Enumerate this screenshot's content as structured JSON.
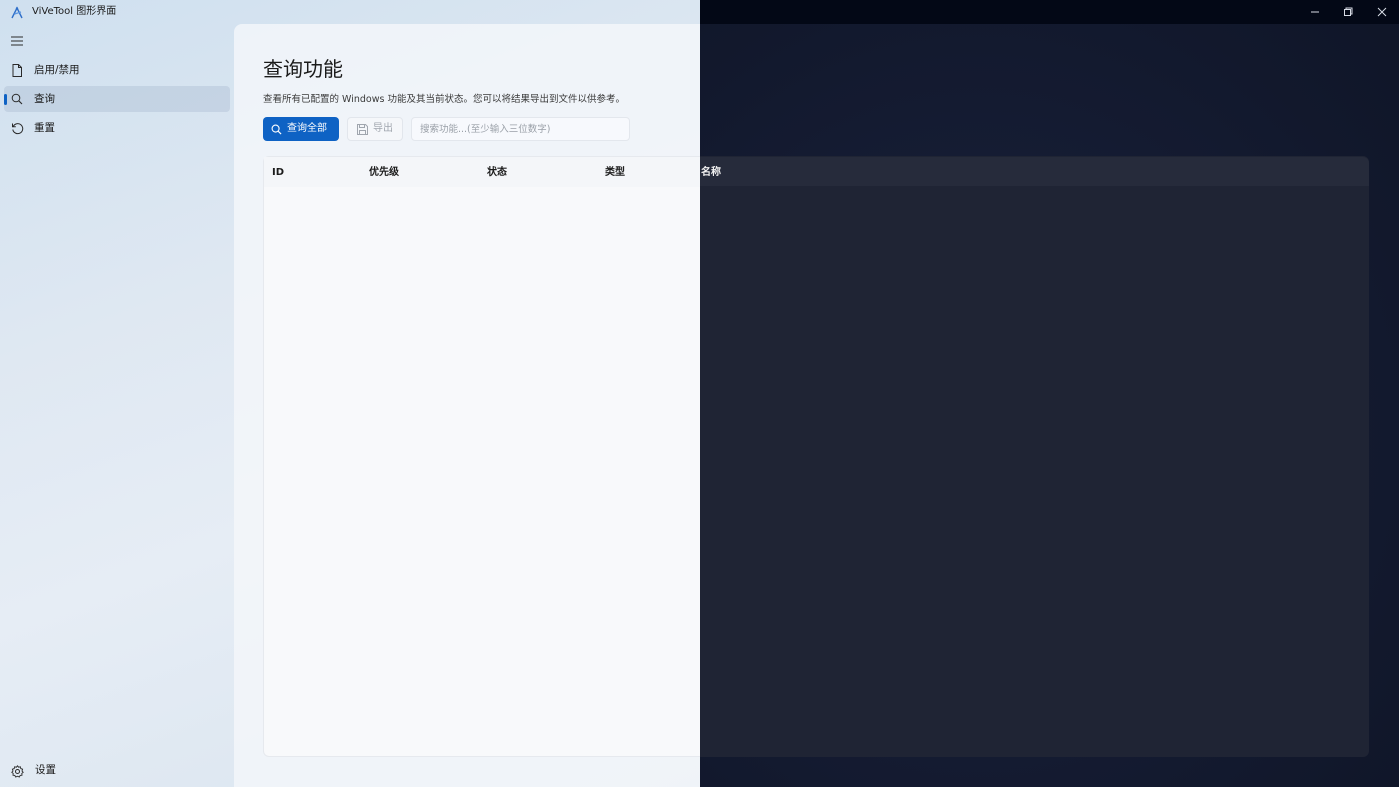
{
  "window": {
    "title": "ViVeTool 图形界面",
    "app_icon": "vivetool-logo-icon",
    "controls": [
      "minimize-icon",
      "restore-icon",
      "close-icon"
    ]
  },
  "sidebar": {
    "menu_icon": "hamburger-icon",
    "items": [
      {
        "label": "启用/禁用",
        "icon": "document-icon",
        "selected": false
      },
      {
        "label": "查询",
        "icon": "search-icon",
        "selected": true
      },
      {
        "label": "重置",
        "icon": "reset-icon",
        "selected": false
      }
    ],
    "footer": {
      "label": "设置",
      "icon": "gear-icon"
    }
  },
  "main": {
    "title": "查询功能",
    "description": "查看所有已配置的 Windows 功能及其当前状态。您可以将结果导出到文件以供参考。",
    "toolbar": {
      "query_all_label": "查询全部",
      "export_label": "导出",
      "search_placeholder": "搜索功能...(至少输入三位数字)"
    },
    "table": {
      "columns": [
        "ID",
        "优先级",
        "状态",
        "类型",
        "名称"
      ],
      "rows": []
    }
  },
  "colors": {
    "accent": "#0e62c4",
    "dark_background": "#151c33",
    "light_background": "#e6edf5"
  }
}
